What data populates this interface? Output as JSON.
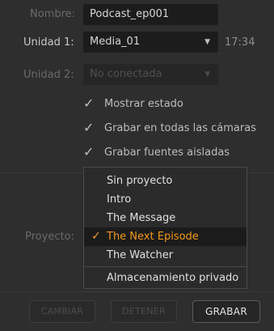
{
  "form": {
    "nombre_label": "Nombre:",
    "nombre_value": "Podcast_ep001",
    "unidad1_label": "Unidad 1:",
    "unidad1_value": "Media_01",
    "unidad1_time": "17:34",
    "unidad2_label": "Unidad 2:",
    "unidad2_value": "No conectada",
    "proyecto_label": "Proyecto:"
  },
  "checkboxes": [
    {
      "label": "Mostrar estado",
      "checked": true
    },
    {
      "label": "Grabar en todas las cámaras",
      "checked": true
    },
    {
      "label": "Grabar fuentes aisladas",
      "checked": true
    }
  ],
  "project_menu": {
    "items": [
      {
        "label": "Sin proyecto",
        "selected": false
      },
      {
        "label": "Intro",
        "selected": false
      },
      {
        "label": "The Message",
        "selected": false
      },
      {
        "label": "The Next Episode",
        "selected": true
      },
      {
        "label": "The Watcher",
        "selected": false
      }
    ],
    "private_storage": "Almacenamiento privado",
    "check_glyph": "✓",
    "accent_color": "#f39a1b"
  },
  "buttons": {
    "cambiar": "CAMBIAR",
    "detener": "DETENER",
    "grabar": "GRABAR"
  },
  "icons": {
    "caret": "▼",
    "check": "✓"
  }
}
